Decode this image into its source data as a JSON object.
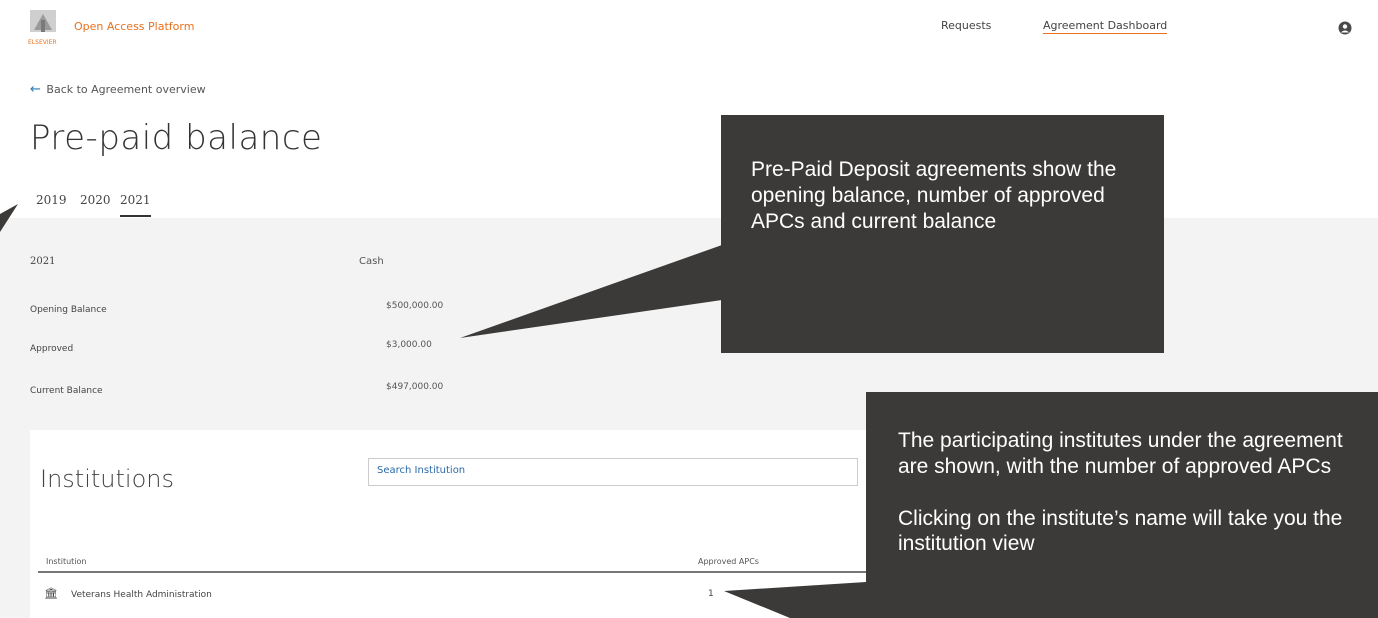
{
  "header": {
    "brand": "Open Access Platform",
    "publisher": "ELSEVIER",
    "nav": [
      {
        "label": "Requests"
      },
      {
        "label": "Agreement Dashboard"
      }
    ]
  },
  "page": {
    "back_link": "Back to Agreement overview",
    "title": "Pre-paid balance",
    "year_tabs": [
      "2019",
      "2020",
      "2021"
    ],
    "active_year": "2021"
  },
  "balance": {
    "year": "2021",
    "currency_type": "Cash",
    "rows": [
      {
        "label": "Opening Balance",
        "value": "$500,000.00"
      },
      {
        "label": "Approved",
        "value": "$3,000.00"
      },
      {
        "label": "Current Balance",
        "value": "$497,000.00"
      }
    ]
  },
  "institutions": {
    "title": "Institutions",
    "search_value": "Search Institution",
    "columns": [
      "Institution",
      "Approved APCs"
    ],
    "rows": [
      {
        "name": "Veterans Health Administration",
        "approved_apcs": "1"
      }
    ]
  },
  "callouts": {
    "deposit": "Pre-Paid Deposit agreements show the opening balance, number of approved APCs and current balance",
    "institutes_p1": "The participating institutes under the agreement are shown, with the number of approved APCs",
    "institutes_p2": "Clicking on the institute’s name will take you the institution view"
  },
  "colors": {
    "brand": "#e9711c",
    "link": "#2a7ab8",
    "callout_bg": "#3b3a39",
    "panel_bg": "#f3f3f3"
  }
}
